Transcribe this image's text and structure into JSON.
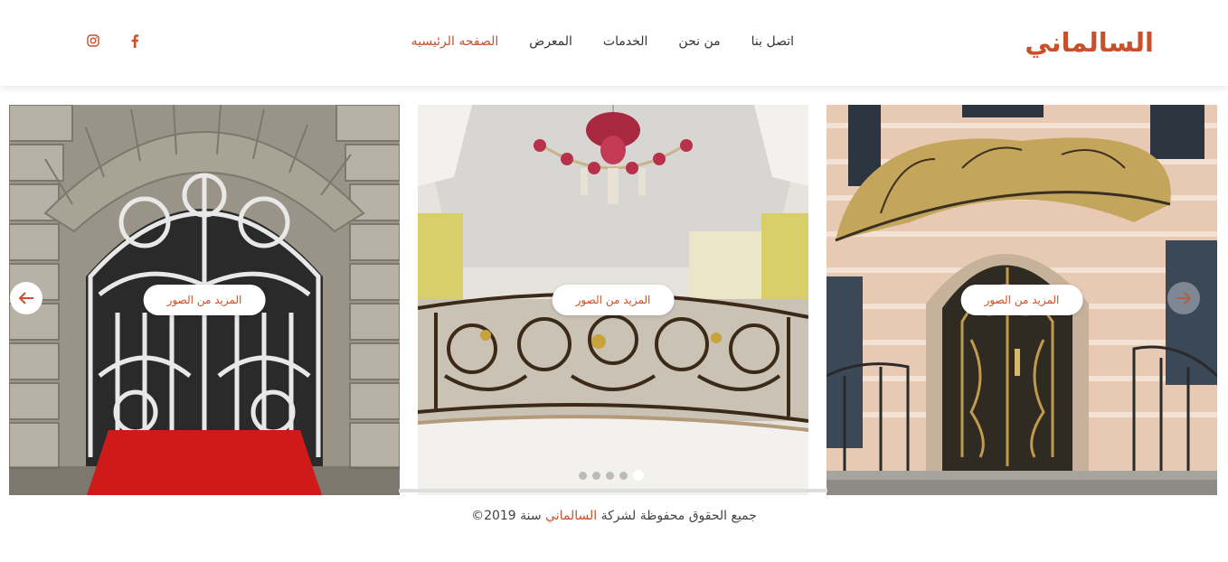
{
  "brand": {
    "name": "السالماني",
    "accent": "#c9502a"
  },
  "nav": {
    "items": [
      {
        "label": "الصفحه الرئيسيه",
        "active": true
      },
      {
        "label": "المعرض",
        "active": false
      },
      {
        "label": "الخدمات",
        "active": false
      },
      {
        "label": "من نحن",
        "active": false
      },
      {
        "label": "اتصل بنا",
        "active": false
      }
    ]
  },
  "social": {
    "facebook_icon": "facebook-icon",
    "instagram_icon": "instagram-icon"
  },
  "gallery": {
    "cards": [
      {
        "button_label": "المزيد من الصور",
        "image": "wrought-iron-arched-gate"
      },
      {
        "button_label": "المزيد من الصور",
        "image": "ornate-balcony-railing-chandelier"
      },
      {
        "button_label": "المزيد من الصور",
        "image": "iron-entrance-door-canopy"
      }
    ],
    "dots_total": 5,
    "active_dot": 5
  },
  "footer": {
    "prefix": "جميع الحقوق محفوظة لشركة",
    "brand": "السالماني",
    "suffix": "سنة 2019©"
  }
}
